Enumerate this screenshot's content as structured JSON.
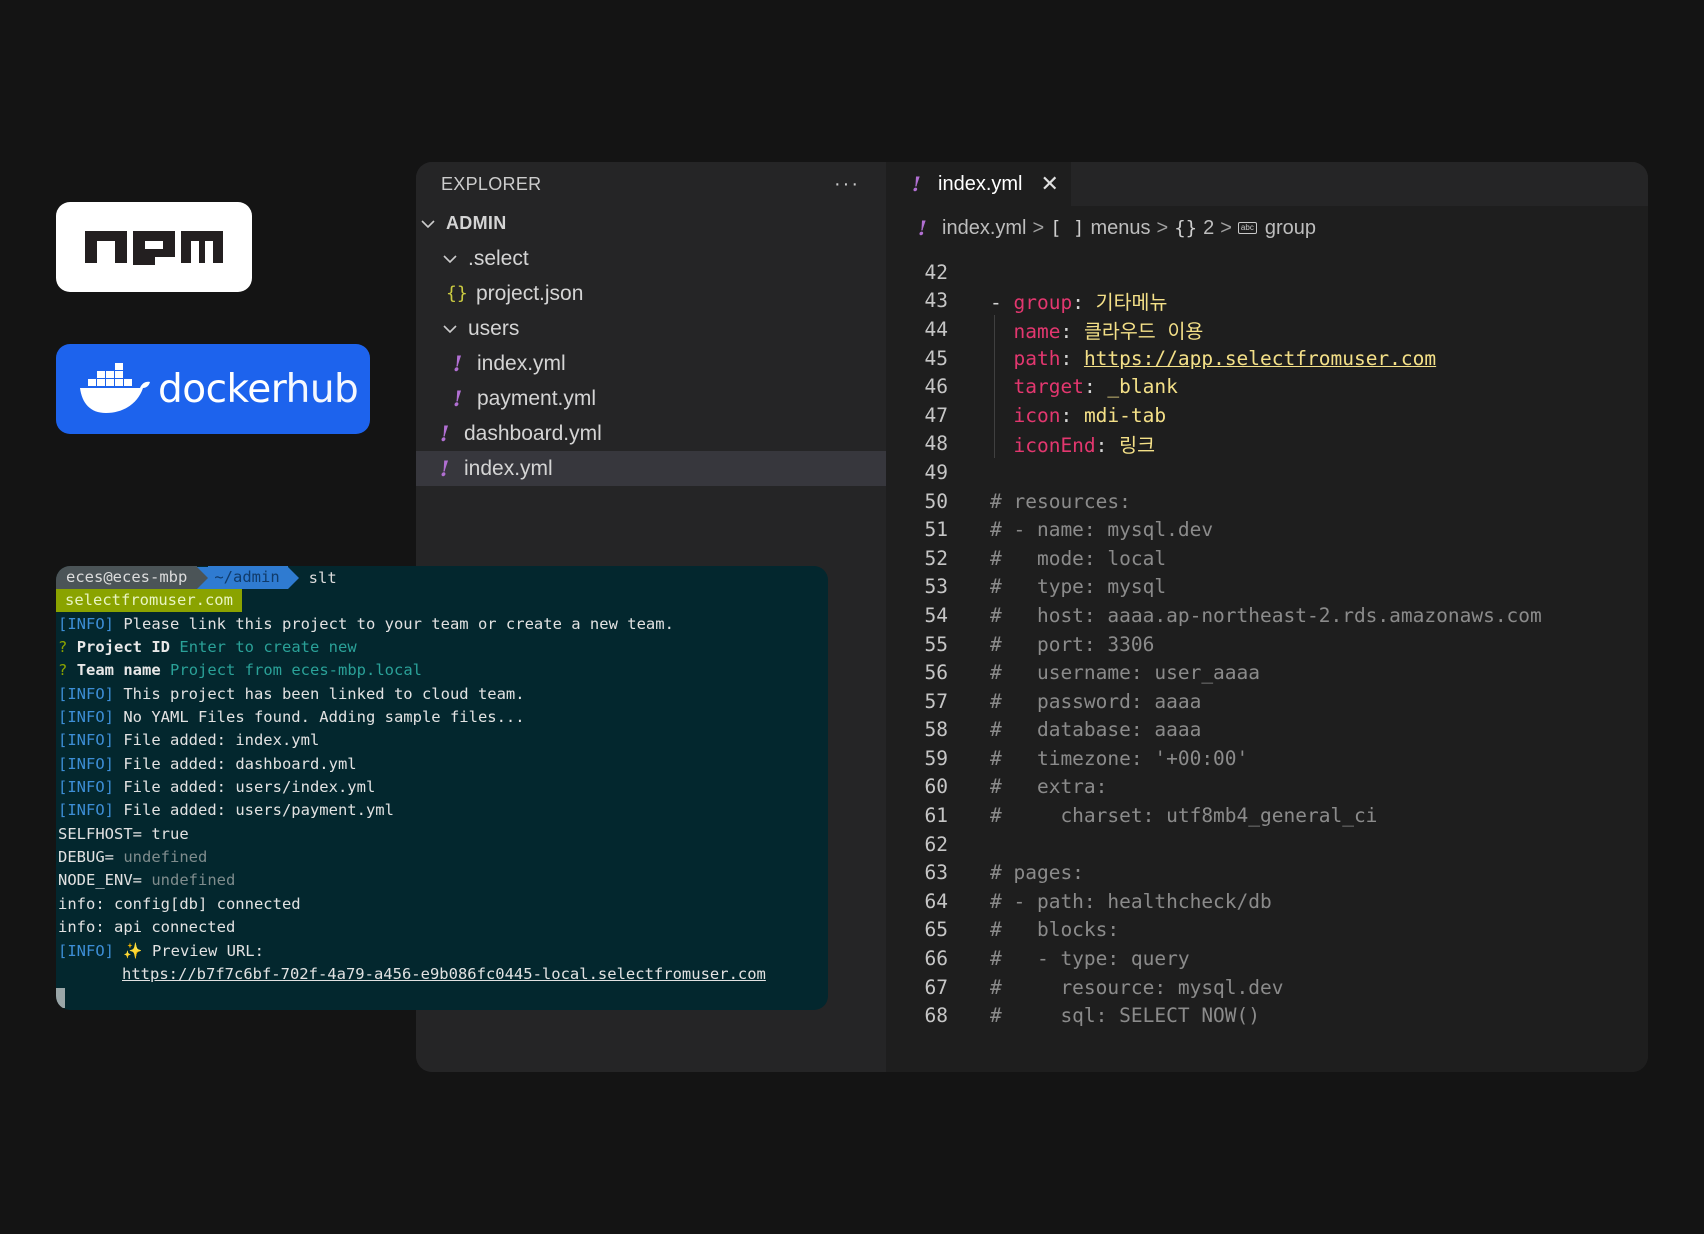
{
  "logos": {
    "npm_label": "npm",
    "docker_label": "docker",
    "docker_hub_label": "hub"
  },
  "explorer": {
    "title": "EXPLORER",
    "more": "···",
    "root": "ADMIN",
    "items": [
      {
        "label": ".select",
        "type": "folder"
      },
      {
        "label": "project.json",
        "type": "json"
      },
      {
        "label": "users",
        "type": "folder"
      },
      {
        "label": "index.yml",
        "type": "yml"
      },
      {
        "label": "payment.yml",
        "type": "yml"
      },
      {
        "label": "dashboard.yml",
        "type": "yml"
      },
      {
        "label": "index.yml",
        "type": "yml",
        "selected": true
      }
    ]
  },
  "editor": {
    "tab": {
      "label": "index.yml",
      "close": "✕"
    },
    "breadcrumb": {
      "file": "index.yml",
      "menus": "menus",
      "menus_icon": "[ ]",
      "obj_icon": "{}",
      "index": "2",
      "abc": "abc",
      "group": "group",
      "sep": ">"
    },
    "lines": [
      {
        "n": "42",
        "text": ""
      },
      {
        "n": "43",
        "dash": "- ",
        "key": "group",
        "val": "기타메뉴"
      },
      {
        "n": "44",
        "key": "name",
        "val": "클라우드 이용"
      },
      {
        "n": "45",
        "key": "path",
        "val": "https://app.selectfromuser.com",
        "link": true
      },
      {
        "n": "46",
        "key": "target",
        "val": "_blank"
      },
      {
        "n": "47",
        "key": "icon",
        "val": "mdi-tab"
      },
      {
        "n": "48",
        "key": "iconEnd",
        "val": "링크"
      },
      {
        "n": "49",
        "text": ""
      },
      {
        "n": "50",
        "comment": "# resources:"
      },
      {
        "n": "51",
        "comment": "# - name: mysql.dev"
      },
      {
        "n": "52",
        "comment": "#   mode: local"
      },
      {
        "n": "53",
        "comment": "#   type: mysql"
      },
      {
        "n": "54",
        "comment": "#   host: aaaa.ap-northeast-2.rds.amazonaws.com"
      },
      {
        "n": "55",
        "comment": "#   port: 3306"
      },
      {
        "n": "56",
        "comment": "#   username: user_aaaa"
      },
      {
        "n": "57",
        "comment": "#   password: aaaa"
      },
      {
        "n": "58",
        "comment": "#   database: aaaa"
      },
      {
        "n": "59",
        "comment": "#   timezone: '+00:00'"
      },
      {
        "n": "60",
        "comment": "#   extra:"
      },
      {
        "n": "61",
        "comment": "#     charset: utf8mb4_general_ci"
      },
      {
        "n": "62",
        "text": ""
      },
      {
        "n": "63",
        "comment": "# pages:"
      },
      {
        "n": "64",
        "comment": "# - path: healthcheck/db"
      },
      {
        "n": "65",
        "comment": "#   blocks:"
      },
      {
        "n": "66",
        "comment": "#   - type: query"
      },
      {
        "n": "67",
        "comment": "#     resource: mysql.dev"
      },
      {
        "n": "68",
        "comment": "#     sql: SELECT NOW()"
      }
    ]
  },
  "terminal": {
    "prompt_user": "eces@eces-mbp",
    "prompt_dir": "~/admin",
    "command": "slt",
    "badge": "selectfromuser.com",
    "info_tag": "[INFO]",
    "q_mark": "?",
    "msg_link": " Please link this project to your team or create a new team.",
    "project_id_label": "Project ID",
    "project_id_hint": "Enter to create new",
    "team_name_label": "Team name",
    "team_name_value": "Project from eces-mbp.local",
    "msg_linked": " This project has been linked to cloud team.",
    "msg_no_yaml": " No YAML Files found. Adding sample files...",
    "file1": " File added: index.yml",
    "file2": " File added: dashboard.yml",
    "file3": " File added: users/index.yml",
    "file4": " File added: users/payment.yml",
    "selfhost_label": "SELFHOST=",
    "selfhost_value": "true",
    "debug_label": "DEBUG=",
    "debug_value": "undefined",
    "node_env_label": "NODE_ENV=",
    "node_env_value": "undefined",
    "db_connected": "info: config[db] connected",
    "api_connected": "info: api connected",
    "preview_label": " ✨ Preview URL:",
    "preview_url": "https://b7f7c6bf-702f-4a79-a456-e9b086fc0445-local.selectfromuser.com"
  }
}
